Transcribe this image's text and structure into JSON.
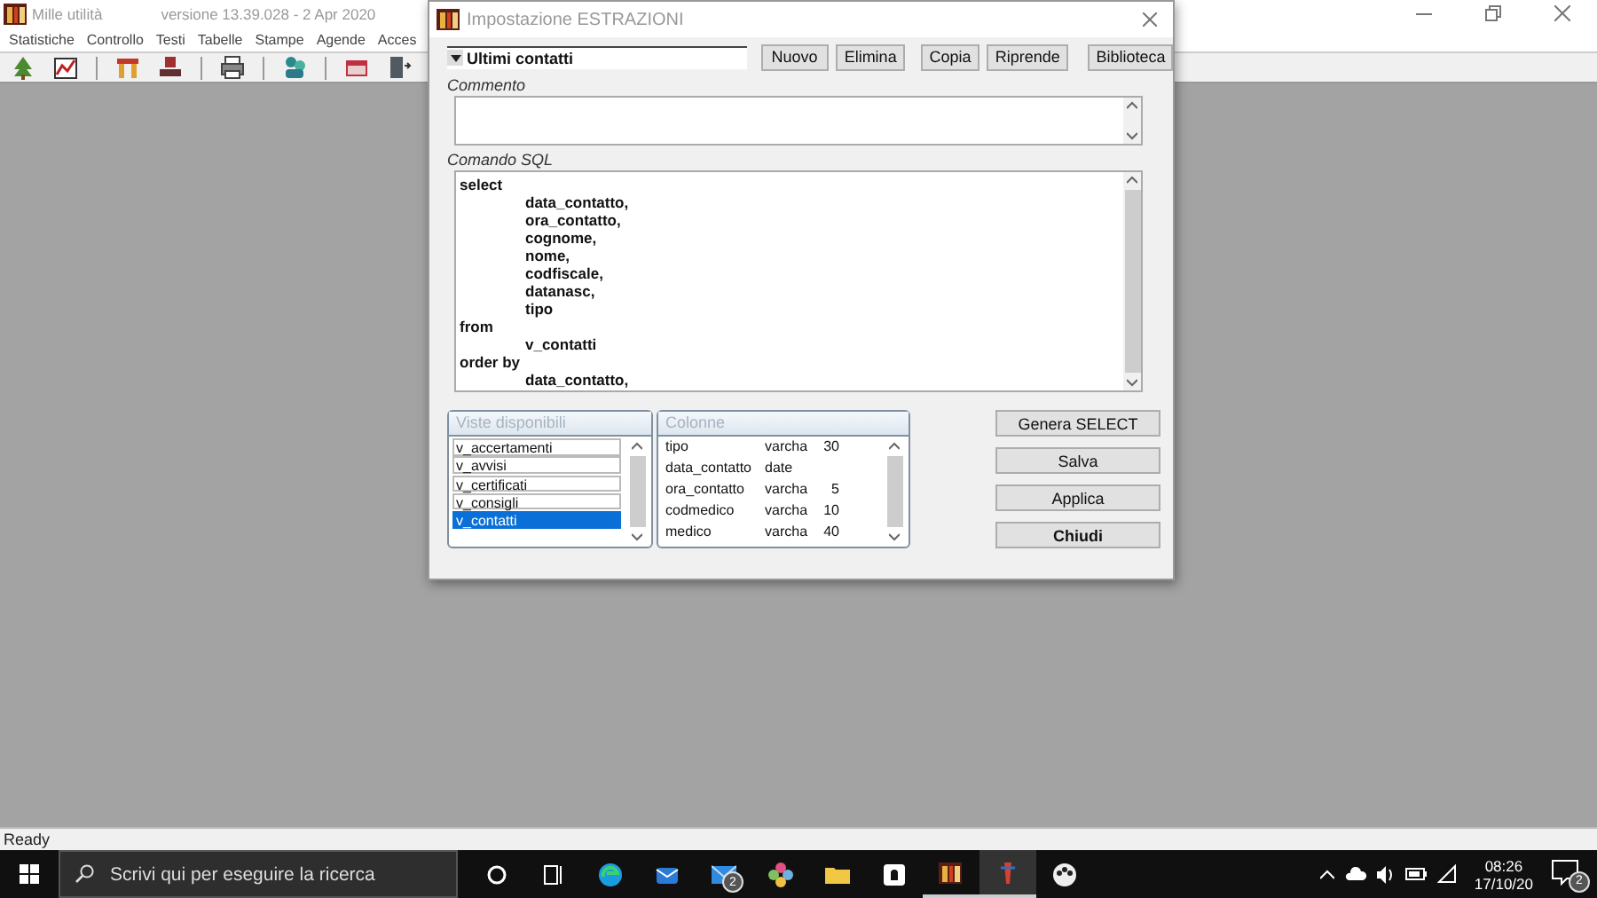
{
  "app": {
    "title": "Mille utilità",
    "version": "versione 13.39.028 - 2 Apr 2020",
    "menu": [
      "Statistiche",
      "Controllo",
      "Testi",
      "Tabelle",
      "Stampe",
      "Agende",
      "Acces"
    ],
    "status_bar": "Ready"
  },
  "dialog": {
    "title": "Impostazione ESTRAZIONI",
    "query_name": "Ultimi contatti",
    "buttons": [
      "Nuovo",
      "Elimina",
      "Copia",
      "Riprende",
      "Biblioteca"
    ],
    "comment": {
      "label": "Commento"
    },
    "sql": {
      "label": "Comando SQL",
      "lines": [
        {
          "kind": "clause",
          "text": "select"
        },
        {
          "kind": "field",
          "text": "data_contatto,"
        },
        {
          "kind": "field",
          "text": "ora_contatto,"
        },
        {
          "kind": "field",
          "text": "cognome,"
        },
        {
          "kind": "field",
          "text": "nome,"
        },
        {
          "kind": "field",
          "text": "codfiscale,"
        },
        {
          "kind": "field",
          "text": "datanasc,"
        },
        {
          "kind": "field",
          "text": "tipo"
        },
        {
          "kind": "clause",
          "text": "from"
        },
        {
          "kind": "field",
          "text": "v_contatti"
        },
        {
          "kind": "clause",
          "text": "order by"
        },
        {
          "kind": "field",
          "text": "data_contatto,"
        }
      ]
    },
    "views": {
      "label": "Viste disponibili",
      "items": [
        {
          "label": "v_accertamenti",
          "selected": false
        },
        {
          "label": "v_avvisi",
          "selected": false
        },
        {
          "label": "v_certificati",
          "selected": false
        },
        {
          "label": "v_consigli",
          "selected": false
        },
        {
          "label": "v_contatti",
          "selected": true
        }
      ]
    },
    "columns": {
      "label": "Colonne",
      "rows": [
        {
          "name": "tipo",
          "type": "varcha",
          "size": "30"
        },
        {
          "name": "data_contatto",
          "type": "date"
        },
        {
          "name": "ora_contatto",
          "type": "varcha",
          "size": "5"
        },
        {
          "name": "codmedico",
          "type": "varcha",
          "size": "10"
        },
        {
          "name": "medico",
          "type": "varcha",
          "size": "40"
        }
      ]
    },
    "actions": [
      {
        "label": "Genera SELECT",
        "kind": "normal"
      },
      {
        "label": "Salva",
        "kind": "normal"
      },
      {
        "label": "Applica",
        "kind": "normal"
      },
      {
        "label": "Chiudi",
        "kind": "default"
      }
    ]
  },
  "taskbar": {
    "search_placeholder": "Scrivi qui per eseguire la ricerca",
    "mail_badge": "2",
    "time": "08:26",
    "date": "17/10/20",
    "notification_badge": "2"
  }
}
